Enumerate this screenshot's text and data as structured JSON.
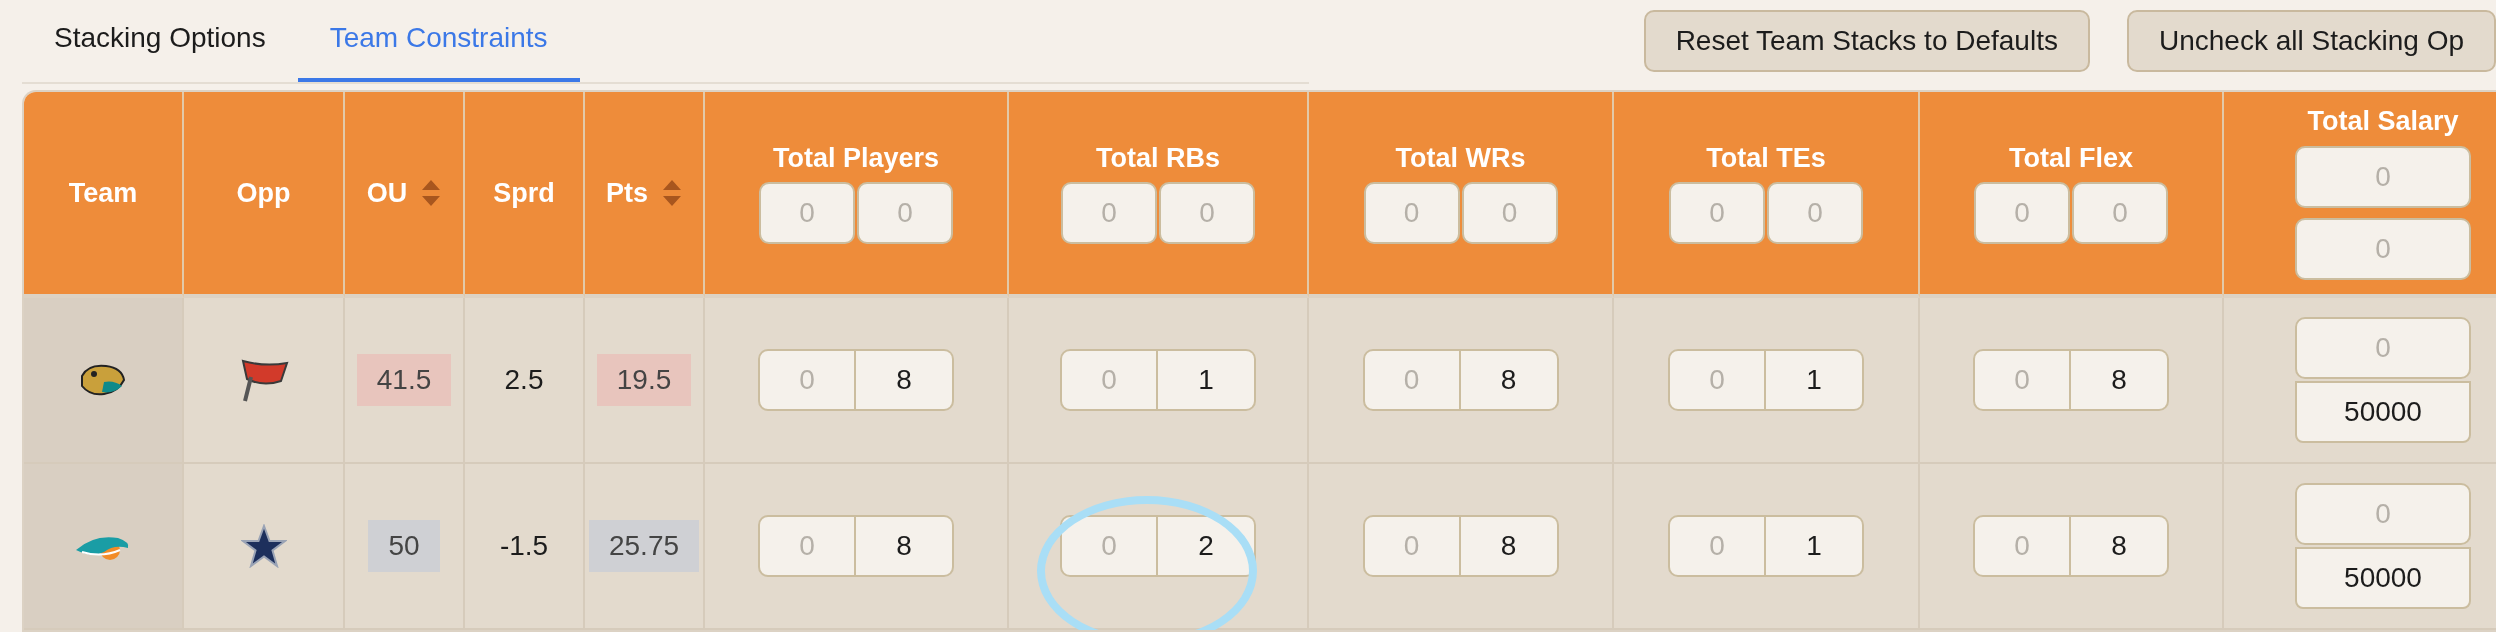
{
  "tabs": [
    {
      "label": "Stacking Options",
      "selected": false
    },
    {
      "label": "Team Constraints",
      "selected": true
    }
  ],
  "buttons": [
    "Reset Team Stacks to Defaults",
    "Uncheck all Stacking Op"
  ],
  "columns": [
    {
      "label": "Team",
      "kind": "plain"
    },
    {
      "label": "Opp",
      "kind": "plain"
    },
    {
      "label": "OU",
      "kind": "sort"
    },
    {
      "label": "Sprd",
      "kind": "plain"
    },
    {
      "label": "Pts",
      "kind": "sort"
    },
    {
      "label": "Total Players",
      "kind": "pair",
      "min_placeholder": "0",
      "max_placeholder": "0"
    },
    {
      "label": "Total RBs",
      "kind": "pair",
      "min_placeholder": "0",
      "max_placeholder": "0"
    },
    {
      "label": "Total WRs",
      "kind": "pair",
      "min_placeholder": "0",
      "max_placeholder": "0"
    },
    {
      "label": "Total TEs",
      "kind": "pair",
      "min_placeholder": "0",
      "max_placeholder": "0"
    },
    {
      "label": "Total Flex",
      "kind": "pair",
      "min_placeholder": "0",
      "max_placeholder": "0"
    },
    {
      "label": "Total Salary",
      "kind": "stack",
      "min_placeholder": "0",
      "max_placeholder": "0"
    }
  ],
  "rows": [
    {
      "team": {
        "kind": "cat"
      },
      "opp": {
        "kind": "flag"
      },
      "ou": {
        "value": "41.5",
        "color": "#e8c5bd"
      },
      "sprd": "2.5",
      "pts": {
        "value": "19.5",
        "color": "#e8c5bd"
      },
      "limits": [
        {
          "min_placeholder": "0",
          "max": "8",
          "circled": false
        },
        {
          "min_placeholder": "0",
          "max": "1",
          "circled": false
        },
        {
          "min_placeholder": "0",
          "max": "8",
          "circled": false
        },
        {
          "min_placeholder": "0",
          "max": "1",
          "circled": false
        },
        {
          "min_placeholder": "0",
          "max": "8",
          "circled": false
        }
      ],
      "salary": {
        "min_placeholder": "0",
        "max": "50000"
      }
    },
    {
      "team": {
        "kind": "dolphin"
      },
      "opp": {
        "kind": "star"
      },
      "ou": {
        "value": "50",
        "color": "#cfd0d4"
      },
      "sprd": "-1.5",
      "pts": {
        "value": "25.75",
        "color": "#cfd0d4"
      },
      "limits": [
        {
          "min_placeholder": "0",
          "max": "8",
          "circled": false
        },
        {
          "min_placeholder": "0",
          "max": "2",
          "circled": true
        },
        {
          "min_placeholder": "0",
          "max": "8",
          "circled": false
        },
        {
          "min_placeholder": "0",
          "max": "1",
          "circled": false
        },
        {
          "min_placeholder": "0",
          "max": "8",
          "circled": false
        }
      ],
      "salary": {
        "min_placeholder": "0",
        "max": "50000"
      }
    }
  ]
}
